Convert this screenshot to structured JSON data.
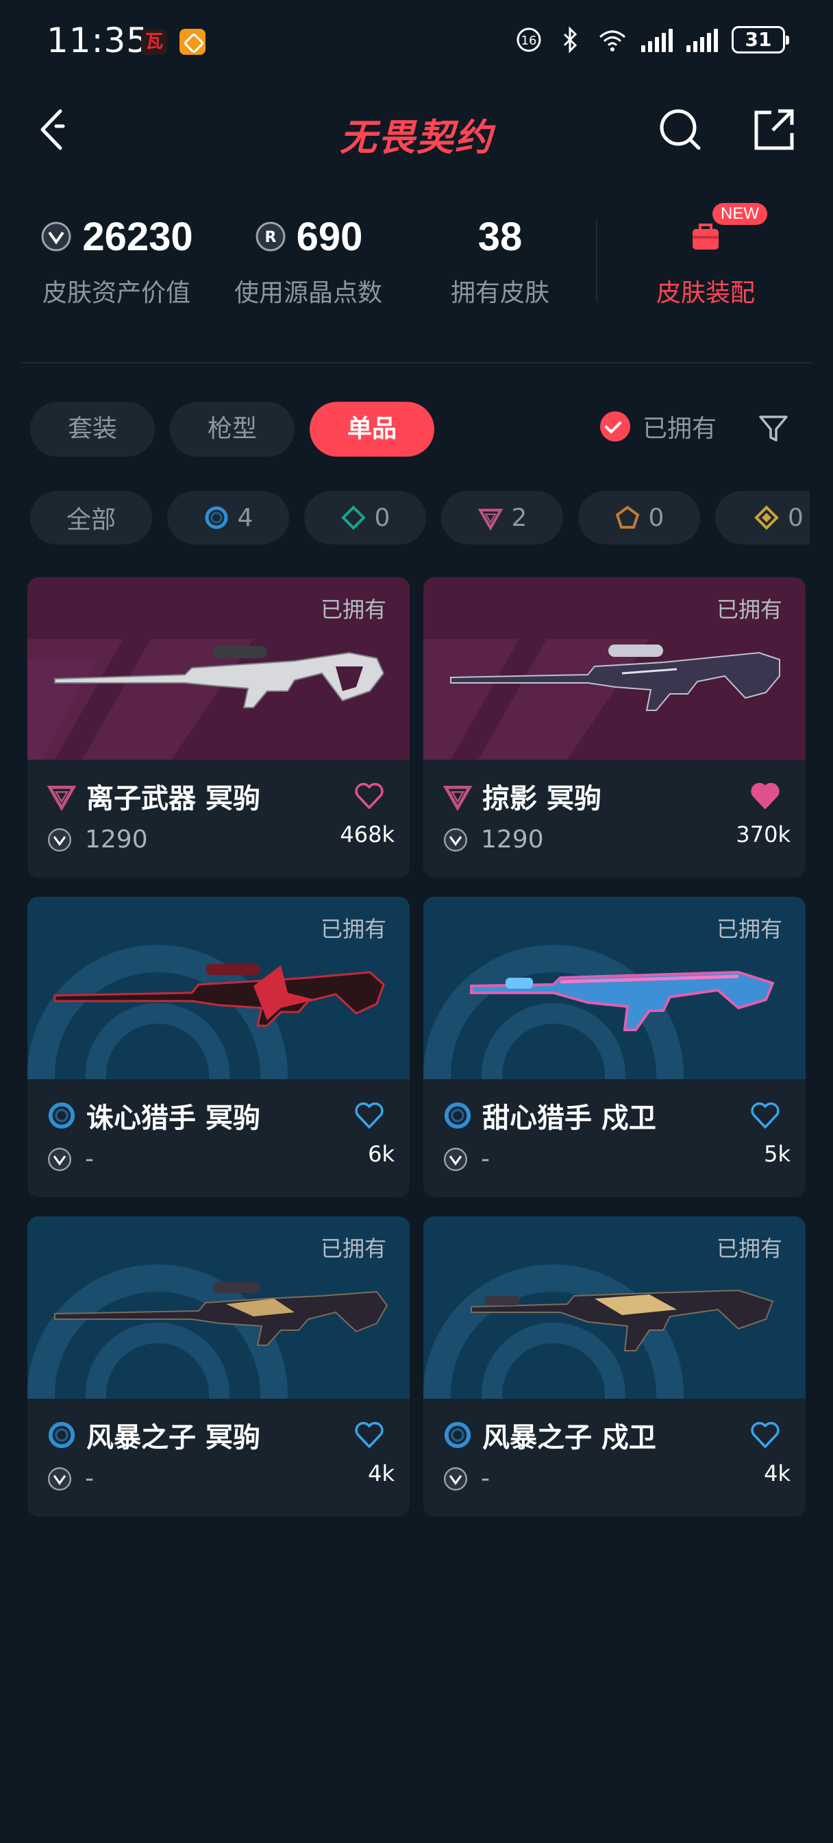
{
  "status": {
    "time": "11:35",
    "battery": "31"
  },
  "header": {
    "title": "无畏契约"
  },
  "stats": [
    {
      "value": "26230",
      "label": "皮肤资产价值",
      "icon": "vp-coin-icon"
    },
    {
      "value": "690",
      "label": "使用源晶点数",
      "icon": "radianite-icon"
    },
    {
      "value": "38",
      "label": "拥有皮肤"
    }
  ],
  "equip": {
    "label": "皮肤装配",
    "badge": "NEW"
  },
  "tabs": [
    {
      "label": "套装"
    },
    {
      "label": "枪型"
    },
    {
      "label": "单品",
      "active": true
    }
  ],
  "owned_filter": {
    "label": "已拥有"
  },
  "chips": [
    {
      "label": "全部"
    },
    {
      "count": "4",
      "tier": "select",
      "color": "#2f8fd4"
    },
    {
      "count": "0",
      "tier": "deluxe",
      "color": "#1aa38a"
    },
    {
      "count": "2",
      "tier": "premium",
      "color": "#c2527f"
    },
    {
      "count": "0",
      "tier": "exclusive",
      "color": "#c07a3a"
    },
    {
      "count": "0",
      "tier": "ultra",
      "color": "#c9a33b"
    }
  ],
  "cards": [
    {
      "owned": "已拥有",
      "name": "离子武器 冥驹",
      "price": "1290",
      "likes": "468k",
      "tier": "premium",
      "liked": false
    },
    {
      "owned": "已拥有",
      "name": "掠影 冥驹",
      "price": "1290",
      "likes": "370k",
      "tier": "premium",
      "liked": true
    },
    {
      "owned": "已拥有",
      "name": "诛心猎手 冥驹",
      "price": "-",
      "likes": "6k",
      "tier": "select",
      "liked": false
    },
    {
      "owned": "已拥有",
      "name": "甜心猎手 戍卫",
      "price": "-",
      "likes": "5k",
      "tier": "select",
      "liked": false
    },
    {
      "owned": "已拥有",
      "name": "风暴之子 冥驹",
      "price": "-",
      "likes": "4k",
      "tier": "select",
      "liked": false
    },
    {
      "owned": "已拥有",
      "name": "风暴之子 戍卫",
      "price": "-",
      "likes": "4k",
      "tier": "select",
      "liked": false
    }
  ],
  "colors": {
    "accent": "#ff4655",
    "background": "#0f1923",
    "surface": "#18232d"
  }
}
